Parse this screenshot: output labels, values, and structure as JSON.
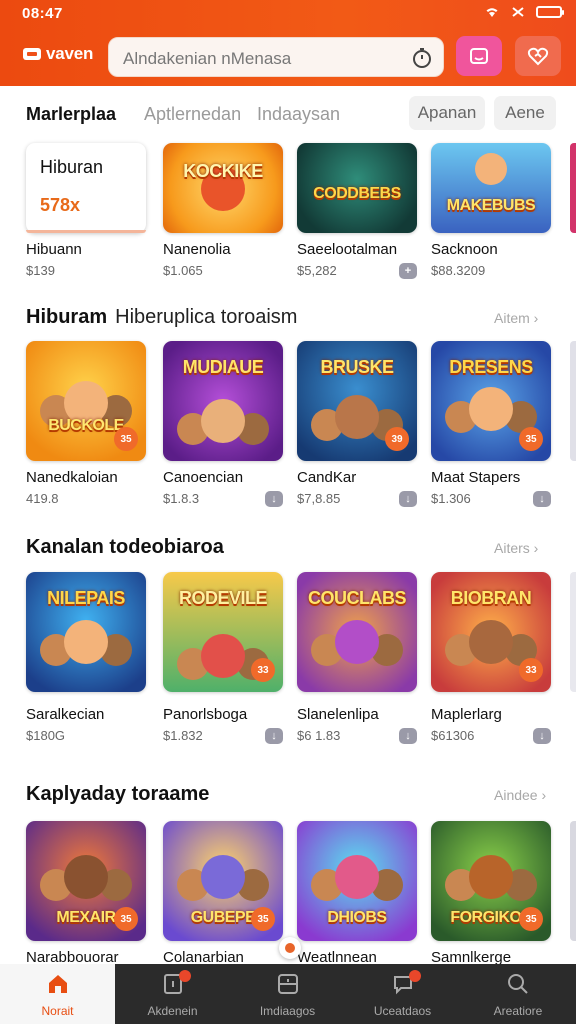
{
  "status": {
    "time": "08:47"
  },
  "header": {
    "brand": "vaven",
    "search_text": "Alndakenian nMenasa"
  },
  "tabs": {
    "active": "Marlerplaa",
    "tab2": "Aptlernedan",
    "tab3": "Indaaysan",
    "pill1": "Apanan",
    "pill2": "Aene"
  },
  "featured": {
    "hiburan_card": {
      "label": "Hiburan",
      "value": "578x"
    },
    "cards": [
      {
        "name": "Hibuann",
        "price": "$139"
      },
      {
        "name": "Nanenolia",
        "price": "$1.065",
        "art": "KOCKIKE"
      },
      {
        "name": "Saeelootalman",
        "price": "$5,282",
        "art": "CODDBEBS"
      },
      {
        "name": "Sacknoon",
        "price": "$88.3209",
        "art": "MAKEBUBS"
      }
    ]
  },
  "section2": {
    "title": "Hiburam",
    "subtitle": "Hiberuplica toroaism",
    "see_all": "Aitem",
    "cards": [
      {
        "name": "Nanedkaloian",
        "price": "419.8",
        "art": "BUCKOLE",
        "badge": "35"
      },
      {
        "name": "Canoencian",
        "price": "$1.8.3",
        "art": "MUDIAUE",
        "badge": ""
      },
      {
        "name": "CandKar",
        "price": "$7,8.85",
        "art": "BRUSKE",
        "badge": "39"
      },
      {
        "name": "Maat Stapers",
        "price": "$1.306",
        "art": "DRESENS",
        "badge": "35"
      }
    ]
  },
  "section3": {
    "title": "Kanalan todeobiaroa",
    "see_all": "Aiters",
    "cards": [
      {
        "name": "Saralkecian",
        "price": "$180G",
        "art": "NILEPAIS"
      },
      {
        "name": "Panorlsboga",
        "price": "$1.832",
        "art": "RODEVILE",
        "badge": "33"
      },
      {
        "name": "Slanelenlipa",
        "price": "$6 1.83",
        "art": "COUCLABS"
      },
      {
        "name": "Maplerlarg",
        "price": "$61306",
        "art": "BIOBRAN",
        "badge": "33"
      }
    ]
  },
  "section4": {
    "title": "Kaplyaday toraame",
    "see_all": "Aindee",
    "cards": [
      {
        "name": "Narabbouorar",
        "price": "",
        "art": "MEXAIR",
        "badge": "35"
      },
      {
        "name": "Colanarbian",
        "price": "",
        "art": "GUBEPE",
        "badge": "35"
      },
      {
        "name": "Weatlnnean",
        "price": "",
        "art": "DHIOBS"
      },
      {
        "name": "Samnlkerge",
        "price": "",
        "art": "FORGIKOS",
        "badge": "35"
      }
    ]
  },
  "bottom_nav": {
    "items": [
      {
        "label": "Norait"
      },
      {
        "label": "Akdenein"
      },
      {
        "label": "Imdiaagos"
      },
      {
        "label": "Uceatdaos"
      },
      {
        "label": "Areatiore"
      }
    ]
  }
}
